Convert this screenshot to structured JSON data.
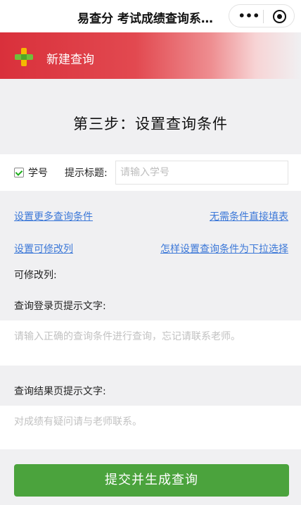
{
  "navbar": {
    "title": "易查分 考试成绩查询系…",
    "more_glyph": "•••"
  },
  "banner": {
    "label": "新建查询"
  },
  "step": {
    "title": "第三步：设置查询条件"
  },
  "field": {
    "checked": true,
    "name": "学号",
    "hint_label": "提示标题:",
    "placeholder": "请输入学号"
  },
  "links": {
    "more_conditions": "设置更多查询条件",
    "fill_direct": "无需条件直接填表",
    "editable_columns": "设置可修改列",
    "dropdown_howto": "怎样设置查询条件为下拉选择"
  },
  "labels": {
    "editable_columns": "可修改列:",
    "login_hint": "查询登录页提示文字:",
    "result_hint": "查询结果页提示文字:"
  },
  "login_hint": {
    "placeholder": "请输入正确的查询条件进行查询，忘记请联系老师。"
  },
  "result_hint": {
    "placeholder": "对成绩有疑问请与老师联系。"
  },
  "submit": {
    "label": "提交并生成查询"
  },
  "colors": {
    "banner_red": "#d9303b",
    "link_blue": "#3c78d8",
    "button_green": "#4ba33d"
  }
}
